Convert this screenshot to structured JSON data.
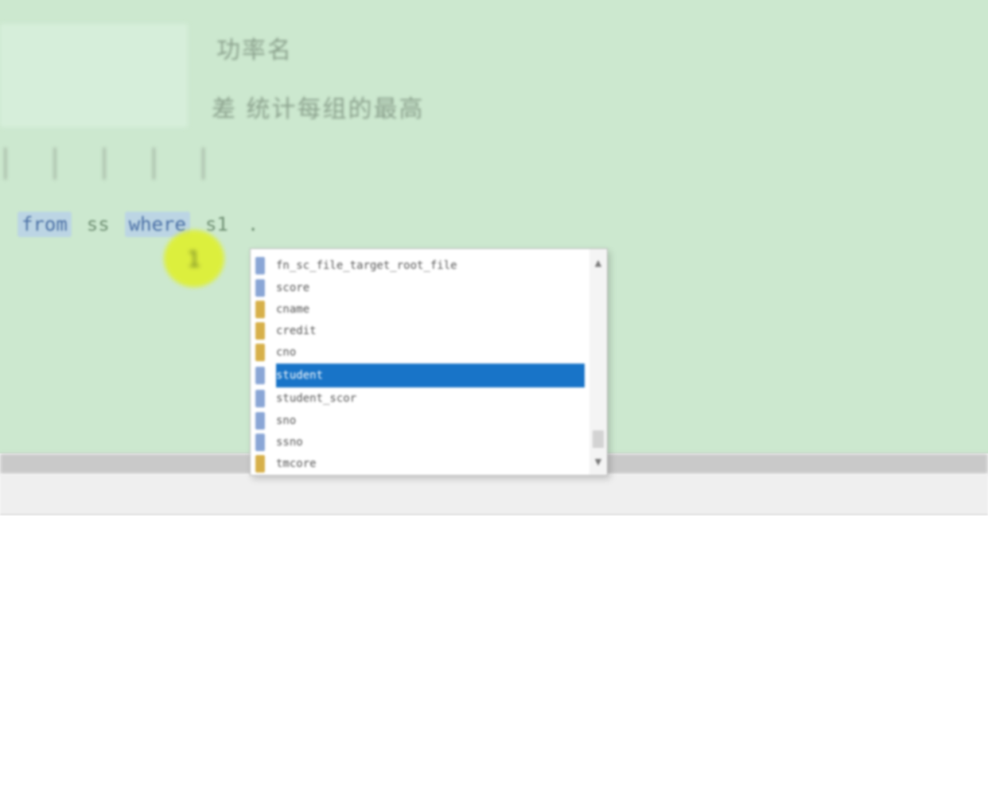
{
  "editor": {
    "comment_line_1": "功率名",
    "comment_line_2": "差  统计每组的最高",
    "faint_glyphs": "| | | | |"
  },
  "sql": {
    "tokens": [
      "from",
      "ss",
      "where",
      "s1",
      "."
    ]
  },
  "cursor_marker": "1",
  "autocomplete": {
    "items": [
      {
        "label": "fn_sc_file_target_root_file",
        "icon": "keyword-icon"
      },
      {
        "label": "score",
        "icon": "keyword-icon"
      },
      {
        "label": "cname",
        "icon": "column-icon"
      },
      {
        "label": "credit",
        "icon": "column-icon"
      },
      {
        "label": "cno",
        "icon": "column-icon"
      },
      {
        "label": "student",
        "icon": "keyword-icon",
        "selected": true
      },
      {
        "label": "student_scor",
        "icon": "keyword-icon"
      },
      {
        "label": "sno",
        "icon": "keyword-icon"
      },
      {
        "label": "ssno",
        "icon": "keyword-icon"
      },
      {
        "label": "tmcore",
        "icon": "column-icon"
      }
    ],
    "selected_index": 5,
    "selection_color": "#1874c8",
    "scroll_up": "▲",
    "scroll_down": "▼"
  },
  "colors": {
    "editor_background": "#cce8cf",
    "results_background": "#ffffff"
  }
}
